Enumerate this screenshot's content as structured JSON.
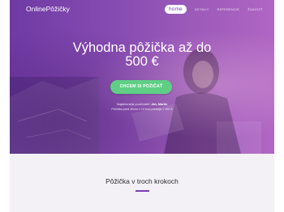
{
  "header": {
    "brand": "OnlinePôžičky",
    "nav": [
      {
        "label": "home"
      },
      {
        "label": "DETAILY"
      },
      {
        "label": "REFERENCIE"
      },
      {
        "label": "ŽIADOSŤ"
      }
    ]
  },
  "hero": {
    "headline_line1": "Výhodna pôžička až do",
    "headline_line2": "500 €",
    "cta_label": "CHCEM SI POŽIČAŤ",
    "last_request_prefix": "Najaktívnejší používateľ:",
    "last_request_name": "Ján, Martin",
    "last_request_detail": "Pôžička pred dňom v 14 hod predaja v 150 €"
  },
  "steps": {
    "title": "Pôžička v troch krokoch"
  },
  "colors": {
    "accent": "#7b3fae",
    "cta": "#5fcf86"
  }
}
